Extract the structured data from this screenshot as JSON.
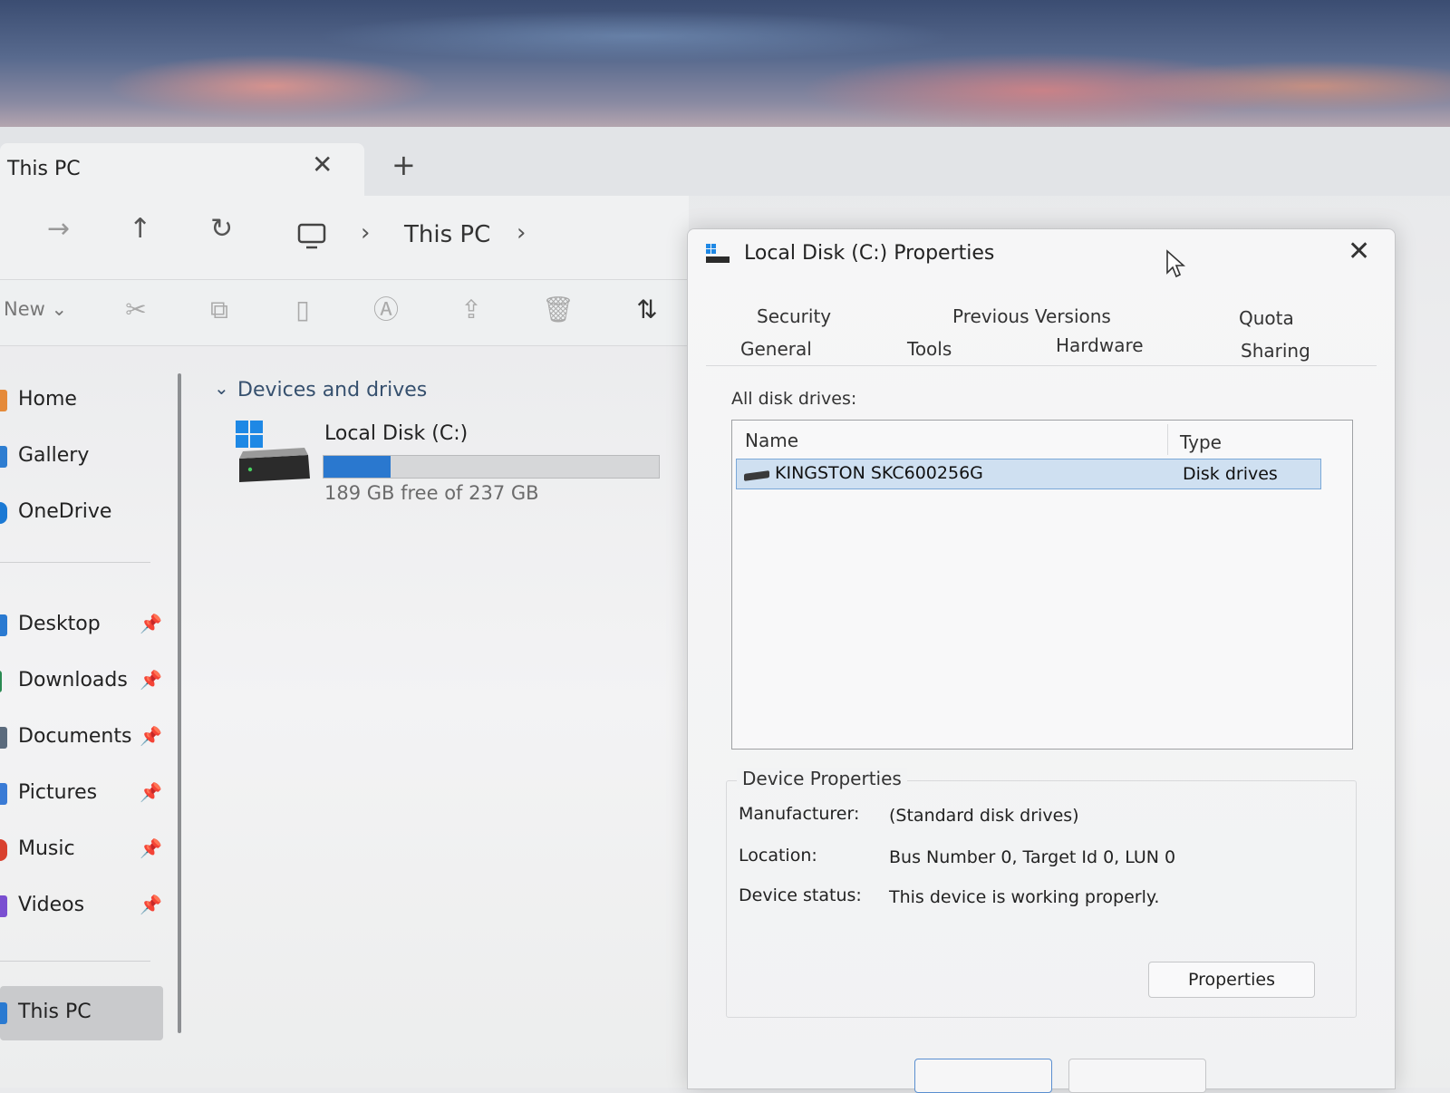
{
  "explorer": {
    "tab_title": "This PC",
    "tab_close": "✕",
    "tab_new": "+",
    "breadcrumb": {
      "current": "This PC",
      "sep": "›"
    },
    "toolbar": {
      "new_label": "New ⌄"
    },
    "sidebar": {
      "items": [
        {
          "label": "Home",
          "icon": "home-icon",
          "color": "#e58a3a"
        },
        {
          "label": "Gallery",
          "icon": "gallery-icon",
          "color": "#2e7dd1"
        },
        {
          "label": "OneDrive",
          "icon": "onedrive-icon",
          "color": "#1b79d4"
        },
        {
          "label": "Desktop",
          "icon": "desktop-icon",
          "color": "#2a7ad1",
          "pinned": true
        },
        {
          "label": "Downloads",
          "icon": "downloads-icon",
          "color": "#2a8a52",
          "pinned": true
        },
        {
          "label": "Documents",
          "icon": "documents-icon",
          "color": "#5b6b7d",
          "pinned": true
        },
        {
          "label": "Pictures",
          "icon": "pictures-icon",
          "color": "#3a7bd5",
          "pinned": true
        },
        {
          "label": "Music",
          "icon": "music-icon",
          "color": "#d9412f",
          "pinned": true
        },
        {
          "label": "Videos",
          "icon": "videos-icon",
          "color": "#7a4fd1",
          "pinned": true
        },
        {
          "label": "This PC",
          "icon": "this-pc-icon",
          "color": "#2a7ad1",
          "selected": true
        }
      ]
    },
    "content": {
      "group_label": "Devices and drives",
      "drive": {
        "name": "Local Disk (C:)",
        "free_text": "189 GB free of 237 GB",
        "used_fraction": 0.2
      }
    }
  },
  "dialog": {
    "title": "Local Disk (C:) Properties",
    "close": "✕",
    "tabs_row1": [
      "Security",
      "Previous Versions",
      "Quota"
    ],
    "tabs_row2": [
      "General",
      "Tools",
      "Hardware",
      "Sharing"
    ],
    "all_disks_label": "All disk drives:",
    "columns": {
      "name": "Name",
      "type": "Type"
    },
    "disks": [
      {
        "name": "KINGSTON SKC600256G",
        "type": "Disk drives",
        "selected": true
      }
    ],
    "device_properties": {
      "title": "Device Properties",
      "manufacturer_label": "Manufacturer:",
      "manufacturer": "(Standard disk drives)",
      "location_label": "Location:",
      "location": "Bus Number 0, Target Id 0, LUN 0",
      "status_label": "Device status:",
      "status": "This device is working properly.",
      "button": "Properties"
    }
  },
  "colors": {
    "accent": "#2a78cf",
    "selection": "#cfe0f1"
  }
}
